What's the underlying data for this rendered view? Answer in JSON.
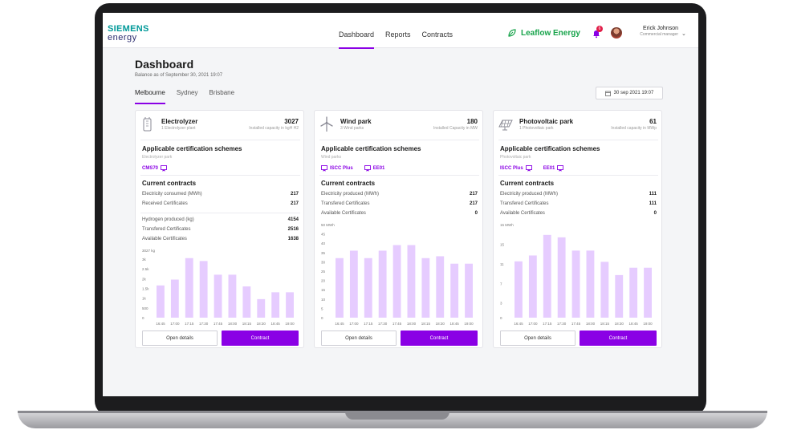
{
  "header": {
    "logo_top": "SIEMENS",
    "logo_bottom": "energy",
    "nav": [
      "Dashboard",
      "Reports",
      "Contracts"
    ],
    "brand": "Leaflow Energy",
    "notification_count": "6",
    "user_name": "Erick Johnson",
    "user_role": "Commercial manager"
  },
  "page": {
    "title": "Dashboard",
    "balance": "Balance as of September 30, 2021 19:07",
    "tabs": [
      "Melbourne",
      "Sydney",
      "Brisbane"
    ],
    "date": "30 sep 2021 19:07"
  },
  "cards": [
    {
      "name": "Electrolyzer",
      "sub": "1 Electrolyzer plant",
      "value": "3027",
      "unit": "Installed capacity in kgH H2",
      "schemes_title": "Applicable certification schemes",
      "schemes_sub": "Electrolyzer park",
      "schemes": [
        "CMS70"
      ],
      "contracts_title": "Current contracts",
      "metrics": [
        {
          "label": "Electricity consumed (MWh)",
          "value": "217"
        },
        {
          "label": "Received Certificates",
          "value": "217"
        },
        {
          "label": "Hydrogen produced (kg)",
          "value": "4154"
        },
        {
          "label": "Transfered Certificates",
          "value": "2516"
        },
        {
          "label": "Available Certificates",
          "value": "1638"
        }
      ],
      "chart_data": {
        "type": "bar",
        "ylabel": "3027 kg",
        "categories": [
          "16:45",
          "17:00",
          "17:15",
          "17:30",
          "17:45",
          "18:00",
          "18:15",
          "18:30",
          "18:45",
          "19:00"
        ],
        "values": [
          1.65,
          1.95,
          3.05,
          2.9,
          2.2,
          2.2,
          1.6,
          0.95,
          1.3,
          1.3
        ],
        "ticks": [
          "3027 kg",
          "3k",
          "2.5k",
          "2k",
          "1.5k",
          "1k",
          "500",
          "0"
        ],
        "tick_values": [
          3.45,
          3.0,
          2.5,
          2.0,
          1.5,
          1.0,
          0.5,
          0
        ],
        "ylim": [
          0,
          3.45
        ]
      },
      "open_label": "Open details",
      "contract_label": "Contract"
    },
    {
      "name": "Wind park",
      "sub": "3 Wind parks",
      "value": "180",
      "unit": "Installed Capacity in MW",
      "schemes_title": "Applicable certification schemes",
      "schemes_sub": "Wind parks",
      "schemes": [
        "ISCC Plus",
        "EE01"
      ],
      "contracts_title": "Current contracts",
      "metrics": [
        {
          "label": "Electricity produced (MWh)",
          "value": "217"
        },
        {
          "label": "Transfered Certificates",
          "value": "217"
        },
        {
          "label": "Available Certificates",
          "value": "0"
        }
      ],
      "chart_data": {
        "type": "bar",
        "ylabel": "50 MWh",
        "categories": [
          "16:45",
          "17:00",
          "17:15",
          "17:30",
          "17:45",
          "18:00",
          "18:15",
          "18:30",
          "18:45",
          "19:00"
        ],
        "values": [
          32,
          36,
          32,
          36,
          39,
          39,
          32,
          33,
          29,
          29
        ],
        "ticks": [
          "50 MWh",
          "45",
          "40",
          "35",
          "30",
          "25",
          "20",
          "15",
          "10",
          "5",
          "0"
        ],
        "tick_values": [
          50,
          45,
          40,
          35,
          30,
          25,
          20,
          15,
          10,
          5,
          0
        ],
        "ylim": [
          0,
          50
        ]
      },
      "open_label": "Open details",
      "contract_label": "Contract"
    },
    {
      "name": "Photovoltaic park",
      "sub": "1 Photovoltaic park",
      "value": "61",
      "unit": "Installed capacity in MWp",
      "schemes_title": "Applicable certification schemes",
      "schemes_sub": "Photovoltaic park",
      "schemes": [
        "ISCC Plus",
        "EE01"
      ],
      "contracts_title": "Current contracts",
      "metrics": [
        {
          "label": "Electricity produced (MWh)",
          "value": "111"
        },
        {
          "label": "Transfered Certificates",
          "value": "111"
        },
        {
          "label": "Available Certificates",
          "value": "0"
        }
      ],
      "chart_data": {
        "type": "bar",
        "ylabel": "15 MWh",
        "categories": [
          "16:45",
          "17:00",
          "17:15",
          "17:30",
          "17:45",
          "18:00",
          "18:15",
          "18:30",
          "18:45",
          "19:00"
        ],
        "values": [
          11.5,
          12.7,
          16.9,
          16.4,
          13.7,
          13.7,
          11.4,
          8.7,
          10.2,
          10.2
        ],
        "ticks": [
          "15 MWh",
          "15",
          "11",
          "7",
          "3",
          "0"
        ],
        "tick_values": [
          19,
          15,
          11,
          7,
          3,
          0
        ],
        "ylim": [
          0,
          19
        ]
      },
      "open_label": "Open details",
      "contract_label": "Contract"
    }
  ],
  "colors": {
    "accent": "#8a00e5",
    "bar": "#e6ccff",
    "brand_green": "#16a34a",
    "siemens_teal": "#009999"
  }
}
